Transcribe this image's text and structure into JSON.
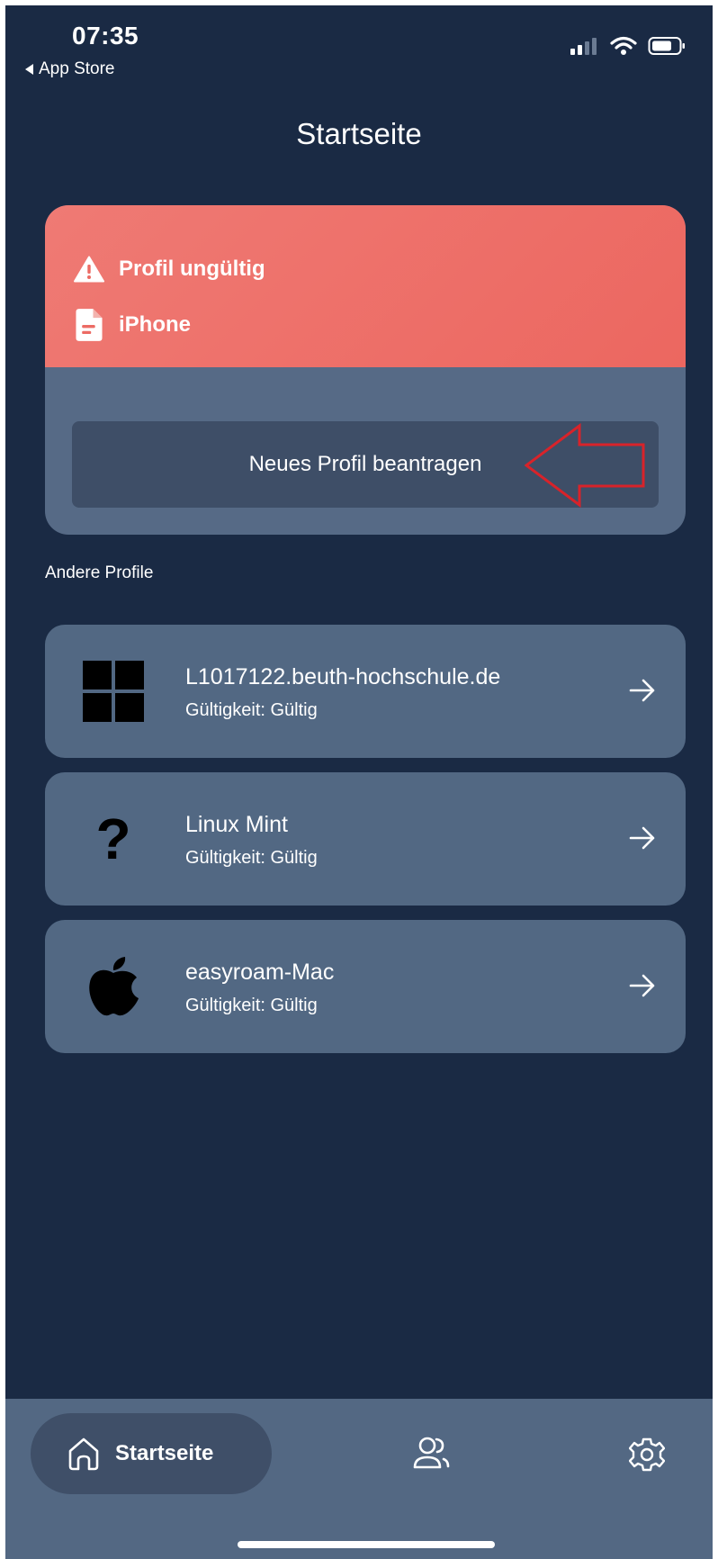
{
  "status_bar": {
    "time": "07:35",
    "back_label": "App Store"
  },
  "header": {
    "title": "Startseite"
  },
  "alert_card": {
    "status_label": "Profil ungültig",
    "device_label": "iPhone",
    "button_label": "Neues Profil beantragen",
    "header_color": "#ec6b64"
  },
  "other_profiles": {
    "section_label": "Andere Profile",
    "items": [
      {
        "icon": "windows-logo-icon",
        "name": "L1017122.beuth-hochschule.de",
        "status": "Gültigkeit: Gültig"
      },
      {
        "icon": "question-mark-icon",
        "name": "Linux Mint",
        "status": "Gültigkeit: Gültig"
      },
      {
        "icon": "apple-logo-icon",
        "name": "easyroam-Mac",
        "status": "Gültigkeit: Gültig"
      }
    ]
  },
  "tab_bar": {
    "home_label": "Startseite",
    "icons": [
      "home-icon",
      "profiles-icon",
      "gear-icon"
    ]
  }
}
